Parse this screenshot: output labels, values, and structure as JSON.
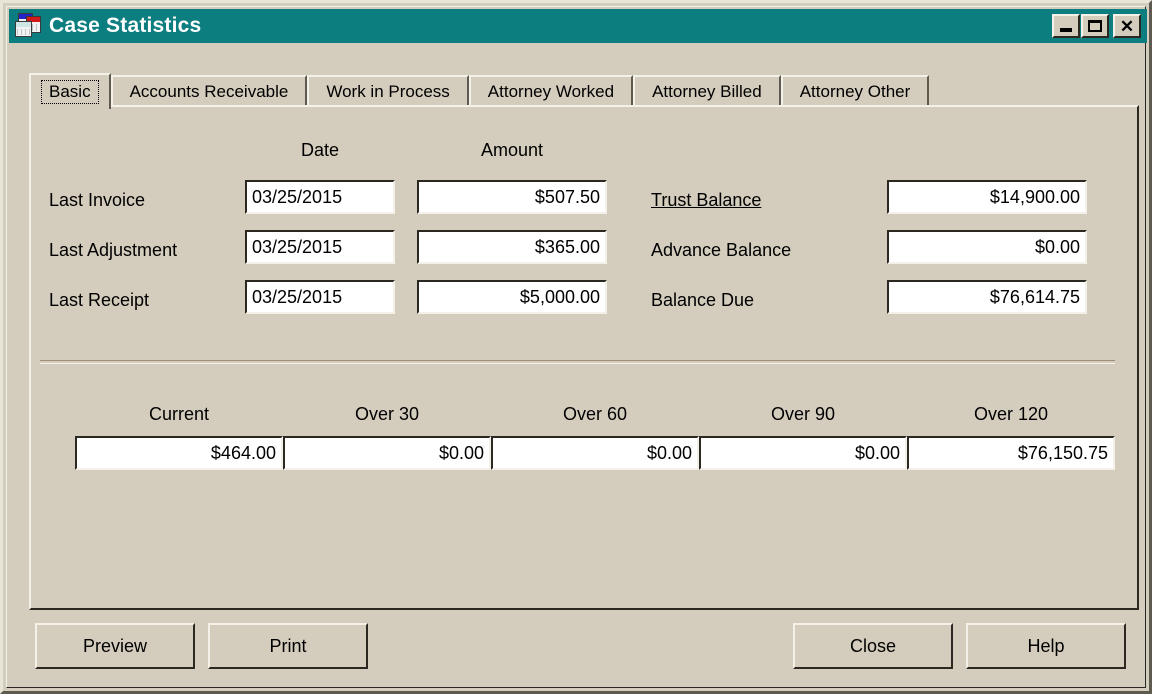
{
  "window": {
    "title": "Case Statistics",
    "icon": "reports-documents-icon",
    "titlebar_color": "#0d7e80",
    "face_color": "#d4cdbd",
    "controls": {
      "minimize": "–",
      "maximize": "□",
      "close": "✕"
    }
  },
  "tabs": [
    {
      "label": "Basic",
      "selected": true
    },
    {
      "label": "Accounts Receivable",
      "selected": false
    },
    {
      "label": "Work in Process",
      "selected": false
    },
    {
      "label": "Attorney Worked",
      "selected": false
    },
    {
      "label": "Attorney Billed",
      "selected": false
    },
    {
      "label": "Attorney Other",
      "selected": false
    }
  ],
  "basic": {
    "column_headers": {
      "date": "Date",
      "amount": "Amount"
    },
    "rows": [
      {
        "label": "Last Invoice",
        "date": "03/25/2015",
        "amount": "$507.50"
      },
      {
        "label": "Last Adjustment",
        "date": "03/25/2015",
        "amount": "$365.00"
      },
      {
        "label": "Last Receipt",
        "date": "03/25/2015",
        "amount": "$5,000.00"
      }
    ],
    "balances": [
      {
        "label": "Trust Balance",
        "value": "$14,900.00",
        "link": true
      },
      {
        "label": "Advance Balance",
        "value": "$0.00",
        "link": false
      },
      {
        "label": "Balance Due",
        "value": "$76,614.75",
        "link": false
      }
    ],
    "aging": {
      "headers": [
        "Current",
        "Over 30",
        "Over 60",
        "Over 90",
        "Over 120"
      ],
      "values": [
        "$464.00",
        "$0.00",
        "$0.00",
        "$0.00",
        "$76,150.75"
      ]
    }
  },
  "footer": {
    "preview": "Preview",
    "print": "Print",
    "close": "Close",
    "help": "Help"
  }
}
